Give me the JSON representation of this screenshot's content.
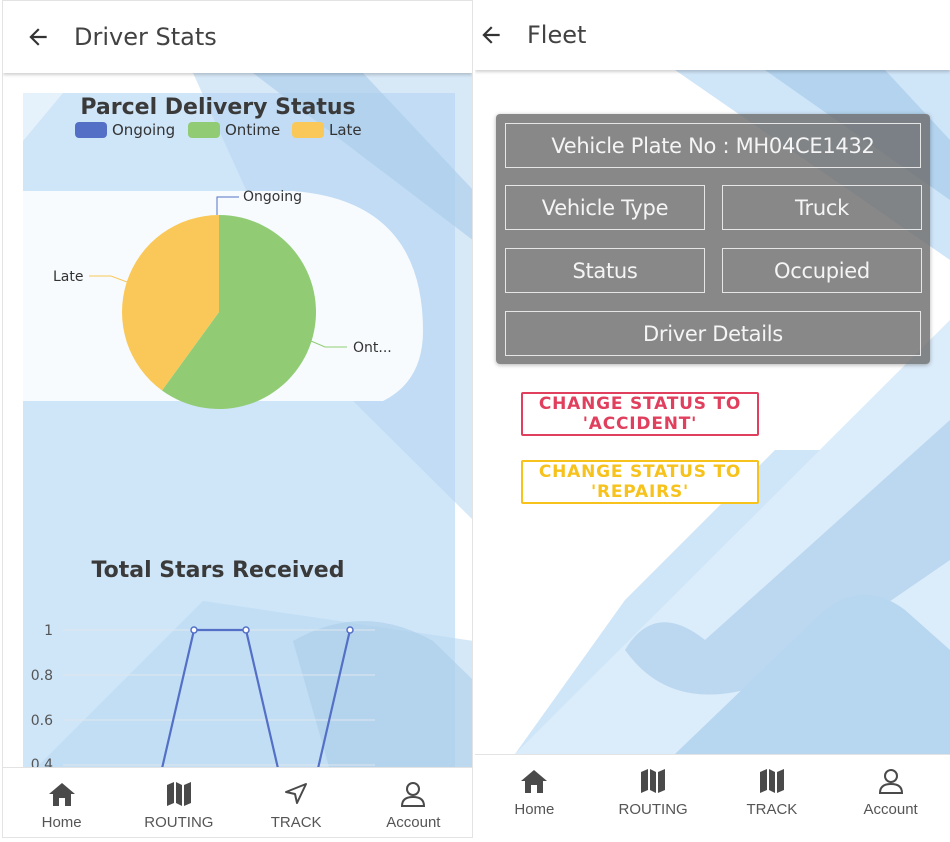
{
  "left_screen": {
    "title": "Driver Stats",
    "pie_chart": {
      "title": "Parcel Delivery Status",
      "legend": [
        {
          "name": "Ongoing",
          "color": "#5470c6"
        },
        {
          "name": "Ontime",
          "color": "#91cc75"
        },
        {
          "name": "Late",
          "color": "#fac858"
        }
      ],
      "slice_labels": {
        "ongoing": "Ongoing",
        "ontime": "Ont...",
        "late": "Late"
      }
    },
    "line_chart": {
      "title": "Total Stars Received",
      "y_ticks": [
        "1",
        "0.8",
        "0.6",
        "0.4"
      ]
    }
  },
  "right_screen": {
    "title": "Fleet",
    "vehicle_card": {
      "plate": "Vehicle Plate No : MH04CE1432",
      "type_label": "Vehicle Type",
      "type_value": "Truck",
      "status_label": "Status",
      "status_value": "Occupied",
      "driver_details": "Driver Details"
    },
    "actions": {
      "accident": "CHANGE STATUS TO 'ACCIDENT'",
      "repairs": "CHANGE STATUS TO 'REPAIRS'"
    }
  },
  "nav": {
    "home": "Home",
    "routing": "ROUTING",
    "track": "TRACK",
    "account": "Account"
  },
  "colors": {
    "accent_red": "#e0405e",
    "accent_yellow": "#f6c21b",
    "bg_blue": "#cfe5f8",
    "bg_blue_dark": "#b3d3ee",
    "series_blue": "#5470c6"
  },
  "chart_data": [
    {
      "type": "pie",
      "title": "Parcel Delivery Status",
      "categories": [
        "Ongoing",
        "Ontime",
        "Late"
      ],
      "values": [
        0,
        3,
        2
      ],
      "legend": "top"
    },
    {
      "type": "line",
      "title": "Total Stars Received",
      "x": [
        1,
        2,
        3,
        4,
        5
      ],
      "series": [
        {
          "values": [
            0,
            1,
            1,
            0,
            1
          ]
        }
      ],
      "ylim": [
        0,
        1
      ],
      "y_ticks": [
        0.4,
        0.6,
        0.8,
        1
      ],
      "grid": true
    }
  ]
}
